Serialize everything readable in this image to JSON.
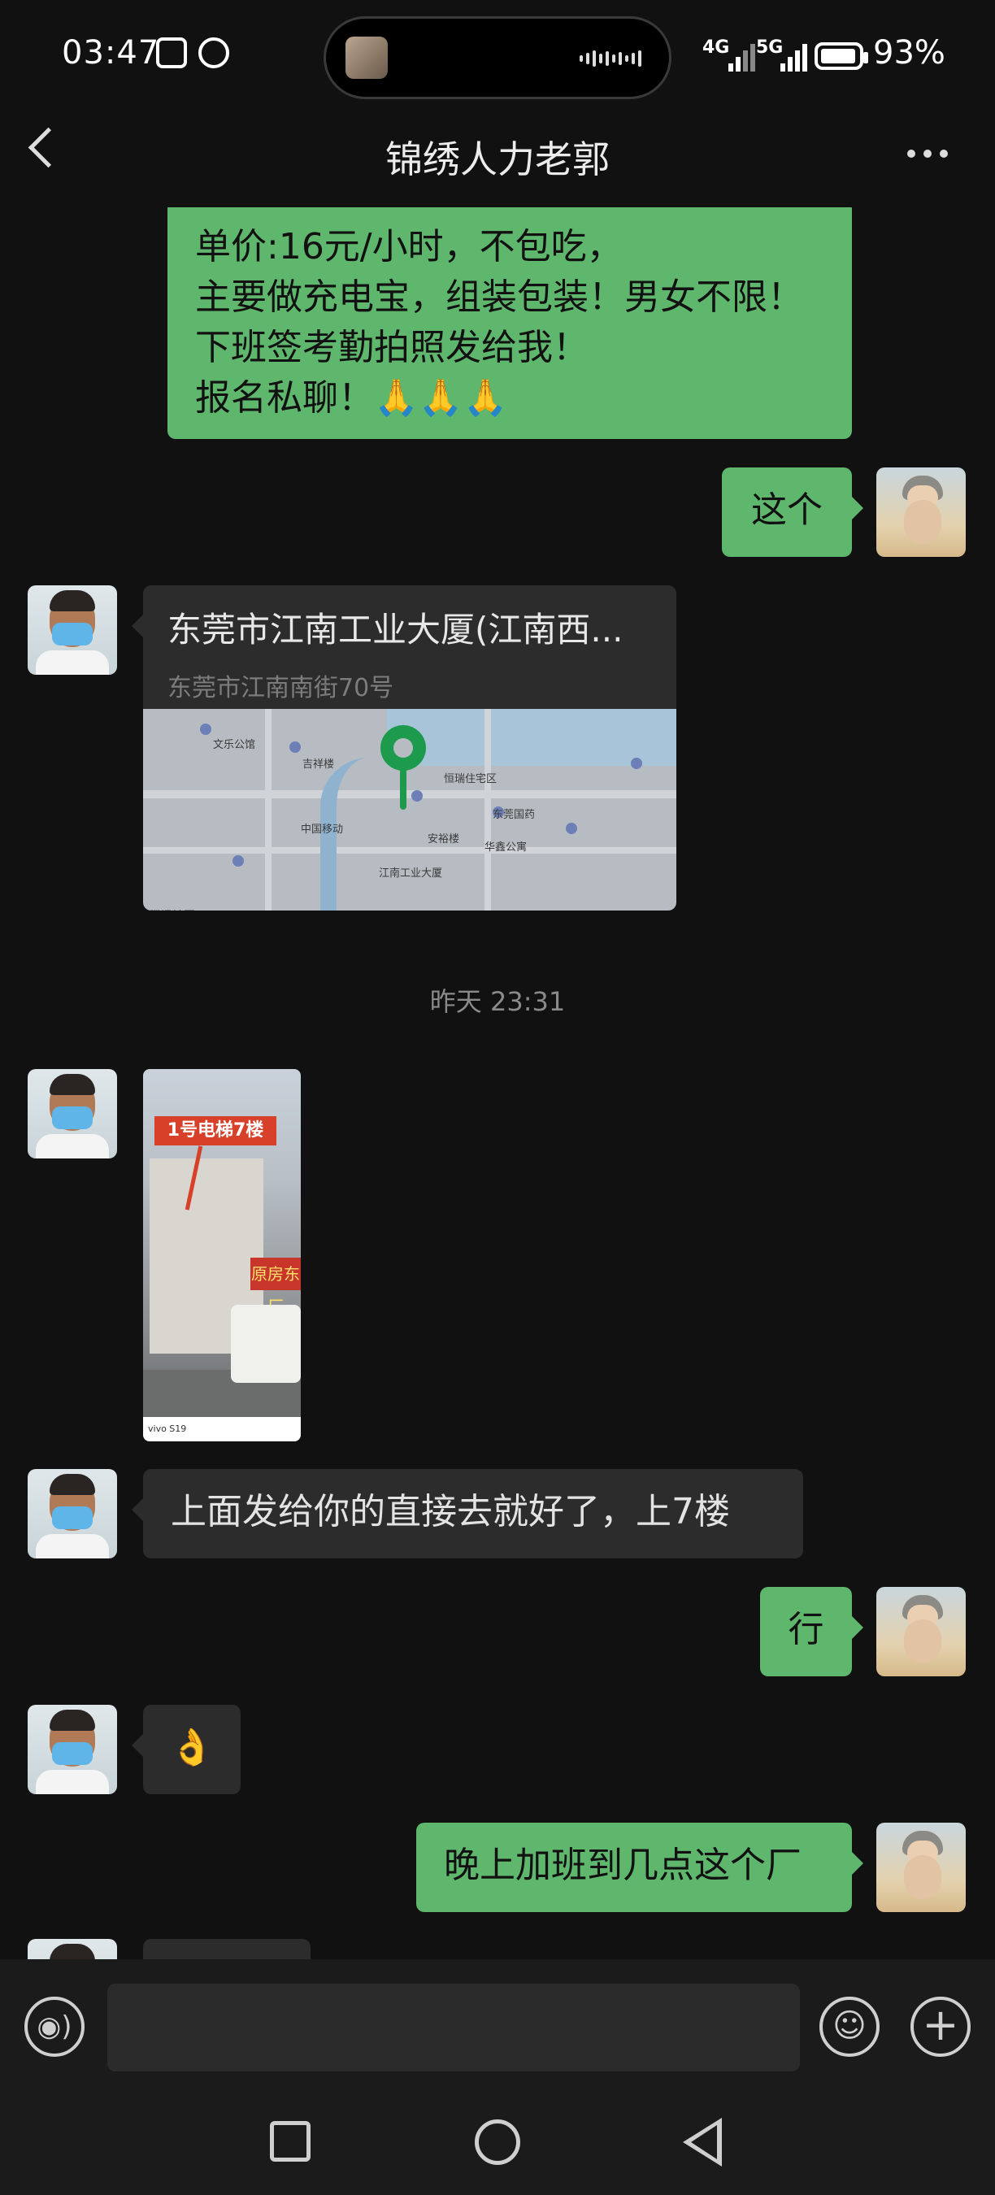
{
  "status_bar": {
    "time": "03:47",
    "network_1": "4G",
    "network_2": "5G",
    "battery": "93%"
  },
  "header": {
    "title": "锦绣人力老郭"
  },
  "messages": {
    "m1_lines": [
      "单价:16元/小时，不包吃，",
      "主要做充电宝，组装包装！男女不限！",
      "下班签考勤拍照发给我！",
      "报名私聊！🙏🙏🙏"
    ],
    "m2": "这个",
    "location": {
      "title": "东莞市江南工业大厦(江南西...",
      "address": "东莞市江南南街70号",
      "map_labels": [
        "文乐公馆",
        "吉祥楼",
        "江南工业大厦",
        "东莞国药",
        "华鑫公寓",
        "恒瑞住宅区",
        "中国移动",
        "安裕楼",
        "腾讯地图"
      ]
    },
    "timestamp": "昨天 23:31",
    "photo": {
      "sign_text": "1号电梯7楼",
      "banner_text": "原房东厂",
      "footer_text": "vivo S19"
    },
    "m4": "上面发给你的直接去就好了，上7楼",
    "m5": "行",
    "m6": "👌",
    "m7": "晚上加班到几点这个厂"
  },
  "input_bar": {
    "placeholder": ""
  },
  "icons": [
    "nfc-icon",
    "alarm-icon",
    "voice-icon",
    "emoji-icon",
    "plus-icon",
    "back-icon",
    "more-icon"
  ]
}
